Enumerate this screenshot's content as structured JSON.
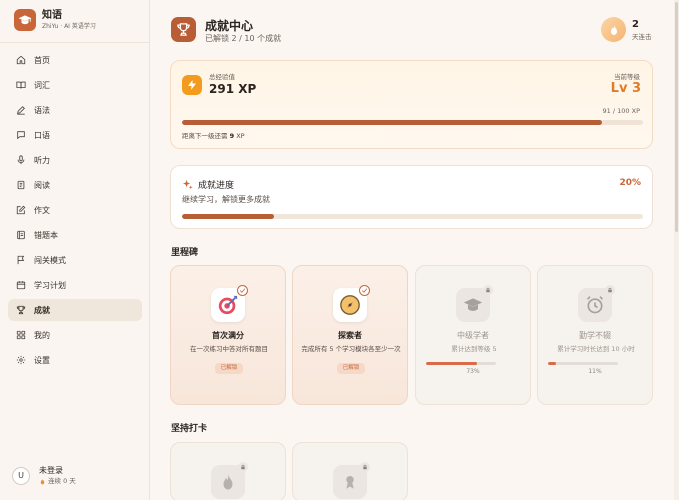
{
  "brand": {
    "name": "知语",
    "subtitle": "ZhiYu · AI 英语学习"
  },
  "nav": [
    {
      "label": "首页",
      "icon": "home-icon"
    },
    {
      "label": "词汇",
      "icon": "book-icon"
    },
    {
      "label": "语法",
      "icon": "pen-icon"
    },
    {
      "label": "口语",
      "icon": "mic-icon"
    },
    {
      "label": "听力",
      "icon": "headphones-icon"
    },
    {
      "label": "阅读",
      "icon": "document-icon"
    },
    {
      "label": "作文",
      "icon": "edit-icon"
    },
    {
      "label": "错题本",
      "icon": "notebook-icon"
    },
    {
      "label": "闯关模式",
      "icon": "flag-icon"
    },
    {
      "label": "学习计划",
      "icon": "calendar-icon"
    },
    {
      "label": "成就",
      "icon": "trophy-icon",
      "active": true
    },
    {
      "label": "我的",
      "icon": "grid-icon"
    },
    {
      "label": "设置",
      "icon": "gear-icon"
    }
  ],
  "user": {
    "avatar": "U",
    "name": "未登录",
    "streak": "连续 0 天"
  },
  "header": {
    "title": "成就中心",
    "subtitle": "已解锁 2 / 10 个成就",
    "streak_value": "2",
    "streak_label": "天连击"
  },
  "xp": {
    "label": "总经验值",
    "value": "291 XP",
    "level_label": "当前等级",
    "level_value": "Lv 3",
    "count": "91 / 100 XP",
    "progress": 0.91,
    "next_prefix": "距离下一级还需",
    "next_amount": "9",
    "next_suffix": "XP"
  },
  "progress": {
    "title": "成就进度",
    "percent_text": "20%",
    "subtitle": "继续学习，解锁更多成就",
    "value": 0.2
  },
  "milestones": {
    "title": "里程碑",
    "items": [
      {
        "name": "首次满分",
        "desc": "在一次练习中答对所有题目",
        "tag": "已解锁",
        "unlocked": true
      },
      {
        "name": "探索者",
        "desc": "完成所有 5 个学习模块各至少一次",
        "tag": "已解锁",
        "unlocked": true
      },
      {
        "name": "中级学者",
        "desc": "累计达到等级 5",
        "percent_text": "73%",
        "progress": 0.73,
        "unlocked": false
      },
      {
        "name": "勤学不辍",
        "desc": "累计学习时长达到 10 小时",
        "percent_text": "11%",
        "progress": 0.11,
        "unlocked": false
      }
    ]
  },
  "streak_section": {
    "title": "坚持打卡"
  },
  "colors": {
    "accent": "#c8663a",
    "xp_orange": "#f29b1d",
    "level_orange": "#e07b2a"
  }
}
